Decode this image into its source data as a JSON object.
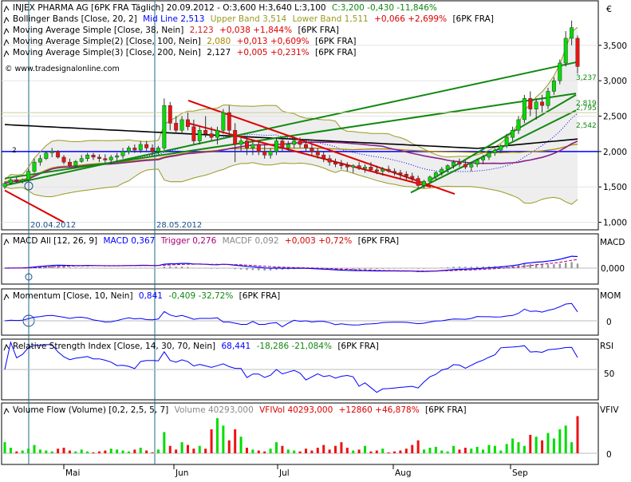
{
  "colors": {
    "up": "#00dd00",
    "down": "#ee1111",
    "neutral": "#888888",
    "mid": "#0000ff",
    "bb": "#999922",
    "sma38": "#cc2222",
    "sma100": "#aa8800",
    "sma200": "#000000",
    "trend": "#118811",
    "signal": "#dd0000"
  },
  "header": {
    "main": {
      "title": "INJEX PHARMA AG [6PK FRA  Täglich] 20.09.2012 - O:3,600 H:3,640 L:3,100",
      "close_change": "C:3,200 -0,430 -11,846%"
    },
    "bb": {
      "label": "Bollinger Bands [Close, 20, 2]",
      "mid": "Mid Line 2,513",
      "upper": "Upper Band 3,514",
      "lower": "Lower Band 1,511",
      "change": "+0,066 +2,699%",
      "suffix": "[6PK FRA]"
    },
    "sma1": {
      "label": "Moving Average Simple [Close, 38, Nein]",
      "value": "2,123",
      "change": "+0,038 +1,844%",
      "suffix": "[6PK FRA]"
    },
    "sma2": {
      "label": "Moving Average Simple(2) [Close, 100, Nein]",
      "value": "2,080",
      "change": "+0,013 +0,609%",
      "suffix": "[6PK FRA]"
    },
    "sma3": {
      "label": "Moving Average Simple(3) [Close, 200, Nein]",
      "value": "2,127",
      "change": "+0,005 +0,231%",
      "suffix": "[6PK FRA]"
    },
    "source": "© www.tradesignalonline.com",
    "macd": {
      "label": "MACD All [12, 26, 9]",
      "macd": "MACD 0,367",
      "trigger": "Trigger 0,276",
      "macdf": "MACDF 0,092",
      "change": "+0,003 +0,72%",
      "suffix": "[6PK FRA]"
    },
    "mom": {
      "label": "Momentum [Close, 10, Nein]",
      "value": "0,841",
      "change": "-0,409 -32,72%",
      "suffix": "[6PK FRA]"
    },
    "rsi": {
      "label": "Relative Strength Index [Close, 14, 30, 70, Nein]",
      "value": "68,441",
      "change": "-18,286 -21,084%",
      "suffix": "[6PK FRA]"
    },
    "vol": {
      "label": "Volume Flow (Volume) [0,2, 2,5, 5, 7]",
      "volume": "Volume 40293,000",
      "vfivol": "VFIVol 40293,000",
      "change": "+12860 +46,878%",
      "suffix": "[6PK FRA]"
    }
  },
  "chart_data": {
    "type": "candlestick",
    "currency": "€",
    "ylim": [
      0.95,
      4.05
    ],
    "price_ticks": [
      "1,000",
      "1,500",
      "2,000",
      "2,500",
      "3,000",
      "3,500"
    ],
    "x_labels": [
      "Mai",
      "Jun",
      "Jul",
      "Aug",
      "Sep"
    ],
    "markers": [
      "20.04.2012",
      "28.05.2012"
    ],
    "annotation_2": "2",
    "trend_labels": [
      "3,237",
      "2,819",
      "2,795",
      "2,542"
    ],
    "candles": [
      [
        1.5,
        1.58,
        1.47,
        1.55
      ],
      [
        1.55,
        1.62,
        1.53,
        1.6
      ],
      [
        1.6,
        1.64,
        1.56,
        1.58
      ],
      [
        1.58,
        1.62,
        1.55,
        1.6
      ],
      [
        1.6,
        1.75,
        1.58,
        1.72
      ],
      [
        1.72,
        1.9,
        1.7,
        1.85
      ],
      [
        1.85,
        1.95,
        1.8,
        1.9
      ],
      [
        1.9,
        2.0,
        1.88,
        1.98
      ],
      [
        1.98,
        2.05,
        1.92,
        2.0
      ],
      [
        2.0,
        2.02,
        1.9,
        1.92
      ],
      [
        1.92,
        1.95,
        1.82,
        1.85
      ],
      [
        1.85,
        1.9,
        1.78,
        1.8
      ],
      [
        1.8,
        1.88,
        1.76,
        1.86
      ],
      [
        1.86,
        1.95,
        1.84,
        1.9
      ],
      [
        1.9,
        1.98,
        1.86,
        1.95
      ],
      [
        1.95,
        1.98,
        1.88,
        1.92
      ],
      [
        1.92,
        1.96,
        1.85,
        1.9
      ],
      [
        1.9,
        1.96,
        1.84,
        1.88
      ],
      [
        1.88,
        1.95,
        1.82,
        1.92
      ],
      [
        1.92,
        1.98,
        1.86,
        1.94
      ],
      [
        1.94,
        2.05,
        1.9,
        2.0
      ],
      [
        2.0,
        2.08,
        1.96,
        2.05
      ],
      [
        2.05,
        2.1,
        1.98,
        2.02
      ],
      [
        2.02,
        2.15,
        1.98,
        2.1
      ],
      [
        2.1,
        2.15,
        2.0,
        2.05
      ],
      [
        2.05,
        2.1,
        1.95,
        2.0
      ],
      [
        2.0,
        2.08,
        1.96,
        2.05
      ],
      [
        2.05,
        2.75,
        2.02,
        2.65
      ],
      [
        2.65,
        2.7,
        2.3,
        2.4
      ],
      [
        2.4,
        2.5,
        2.25,
        2.3
      ],
      [
        2.3,
        2.5,
        2.25,
        2.45
      ],
      [
        2.45,
        2.55,
        2.3,
        2.35
      ],
      [
        2.35,
        2.45,
        2.1,
        2.15
      ],
      [
        2.15,
        2.35,
        2.1,
        2.3
      ],
      [
        2.3,
        2.5,
        2.2,
        2.25
      ],
      [
        2.25,
        2.35,
        2.15,
        2.2
      ],
      [
        2.2,
        2.35,
        2.1,
        2.3
      ],
      [
        2.3,
        2.6,
        2.25,
        2.55
      ],
      [
        2.55,
        2.65,
        2.2,
        2.3
      ],
      [
        2.3,
        2.4,
        1.85,
        2.1
      ],
      [
        2.1,
        2.2,
        2.0,
        2.15
      ],
      [
        2.15,
        2.2,
        1.95,
        2.05
      ],
      [
        2.05,
        2.15,
        1.95,
        2.1
      ],
      [
        2.1,
        2.15,
        1.95,
        2.0
      ],
      [
        2.0,
        2.1,
        1.9,
        1.95
      ],
      [
        1.95,
        2.05,
        1.9,
        2.0
      ],
      [
        2.0,
        2.2,
        1.95,
        2.15
      ],
      [
        2.15,
        2.2,
        2.0,
        2.05
      ],
      [
        2.05,
        2.15,
        2.0,
        2.1
      ],
      [
        2.1,
        2.2,
        2.05,
        2.15
      ],
      [
        2.15,
        2.2,
        2.05,
        2.1
      ],
      [
        2.1,
        2.15,
        2.0,
        2.05
      ],
      [
        2.05,
        2.1,
        1.95,
        2.0
      ],
      [
        2.0,
        2.05,
        1.9,
        1.95
      ],
      [
        1.95,
        2.0,
        1.85,
        1.9
      ],
      [
        1.9,
        1.95,
        1.8,
        1.85
      ],
      [
        1.85,
        1.9,
        1.78,
        1.82
      ],
      [
        1.82,
        1.88,
        1.75,
        1.8
      ],
      [
        1.8,
        1.85,
        1.72,
        1.78
      ],
      [
        1.78,
        1.82,
        1.7,
        1.8
      ],
      [
        1.8,
        1.85,
        1.74,
        1.76
      ],
      [
        1.76,
        1.82,
        1.7,
        1.78
      ],
      [
        1.78,
        1.85,
        1.72,
        1.74
      ],
      [
        1.74,
        1.8,
        1.68,
        1.72
      ],
      [
        1.72,
        1.78,
        1.66,
        1.75
      ],
      [
        1.75,
        1.8,
        1.7,
        1.72
      ],
      [
        1.72,
        1.76,
        1.66,
        1.7
      ],
      [
        1.7,
        1.74,
        1.62,
        1.68
      ],
      [
        1.68,
        1.72,
        1.6,
        1.65
      ],
      [
        1.65,
        1.7,
        1.58,
        1.62
      ],
      [
        1.62,
        1.66,
        1.48,
        1.52
      ],
      [
        1.52,
        1.6,
        1.48,
        1.58
      ],
      [
        1.58,
        1.66,
        1.55,
        1.64
      ],
      [
        1.64,
        1.72,
        1.6,
        1.7
      ],
      [
        1.7,
        1.78,
        1.66,
        1.75
      ],
      [
        1.75,
        1.82,
        1.7,
        1.8
      ],
      [
        1.8,
        1.88,
        1.76,
        1.85
      ],
      [
        1.85,
        1.9,
        1.78,
        1.82
      ],
      [
        1.82,
        1.88,
        1.75,
        1.78
      ],
      [
        1.78,
        1.85,
        1.72,
        1.82
      ],
      [
        1.82,
        1.9,
        1.78,
        1.88
      ],
      [
        1.88,
        1.95,
        1.82,
        1.92
      ],
      [
        1.92,
        2.0,
        1.88,
        1.98
      ],
      [
        1.98,
        2.05,
        1.94,
        2.02
      ],
      [
        2.02,
        2.1,
        1.98,
        2.08
      ],
      [
        2.08,
        2.25,
        2.05,
        2.2
      ],
      [
        2.2,
        2.35,
        2.15,
        2.3
      ],
      [
        2.3,
        2.5,
        2.25,
        2.45
      ],
      [
        2.45,
        2.8,
        2.4,
        2.75
      ],
      [
        2.75,
        2.85,
        2.5,
        2.6
      ],
      [
        2.6,
        2.75,
        2.45,
        2.7
      ],
      [
        2.7,
        2.8,
        2.55,
        2.65
      ],
      [
        2.65,
        2.9,
        2.6,
        2.85
      ],
      [
        2.85,
        3.05,
        2.8,
        3.0
      ],
      [
        3.0,
        3.3,
        2.95,
        3.25
      ],
      [
        3.25,
        3.7,
        3.2,
        3.6
      ],
      [
        3.6,
        3.85,
        3.5,
        3.75
      ],
      [
        3.6,
        3.64,
        3.1,
        3.2
      ]
    ],
    "volumes": [
      12000,
      6000,
      2000,
      3000,
      5000,
      9000,
      4000,
      3000,
      2000,
      5000,
      6000,
      3000,
      2000,
      4000,
      2000,
      1000,
      2000,
      3000,
      5000,
      4000,
      3000,
      2000,
      4000,
      6000,
      3000,
      1000,
      4000,
      23000,
      8000,
      4000,
      12000,
      9000,
      5000,
      8000,
      5000,
      26000,
      38000,
      30000,
      14000,
      26000,
      18000,
      6000,
      4000,
      3000,
      2000,
      5000,
      12000,
      8000,
      4000,
      3000,
      2000,
      5000,
      3000,
      6000,
      9000,
      4000,
      8000,
      12000,
      6000,
      3000,
      4000,
      8000,
      2000,
      3000,
      5000,
      1000,
      2000,
      3000,
      5000,
      9000,
      14000,
      4000,
      6000,
      7000,
      3000,
      2000,
      8000,
      4000,
      6000,
      5000,
      7000,
      4000,
      9000,
      8000,
      3000,
      10000,
      16000,
      12000,
      8000,
      20000,
      18000,
      14000,
      22000,
      16000,
      26000,
      30000,
      12000,
      40293
    ],
    "macd_axis": [
      "0,000"
    ],
    "mom_axis": [
      "0"
    ],
    "rsi_axis": [
      "50"
    ],
    "vol_axis": [
      "0"
    ],
    "panel_labels": [
      "MACD",
      "MOM",
      "RSI",
      "VFIV"
    ]
  }
}
